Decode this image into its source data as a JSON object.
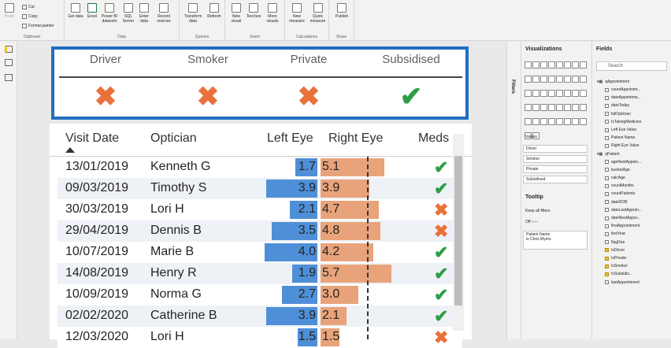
{
  "ribbon": {
    "clipboard": {
      "paste": "Paste",
      "cut": "Cut",
      "copy": "Copy",
      "format_painter": "Format painter",
      "label": "Clipboard"
    },
    "data": {
      "get_data": "Get data",
      "excel": "Excel",
      "power_bi_datasets": "Power BI datasets",
      "sql_server": "SQL Server",
      "enter_data": "Enter data",
      "recent_sources": "Recent sources",
      "label": "Data"
    },
    "queries": {
      "transform_data": "Transform data",
      "refresh": "Refresh",
      "label": "Queries"
    },
    "insert": {
      "new_visual": "New visual",
      "text_box": "Text box",
      "more_visuals": "More visuals",
      "label": "Insert"
    },
    "calculations": {
      "new_measure": "New measure",
      "quick_measure": "Quick measure",
      "label": "Calculations"
    },
    "share": {
      "publish": "Publish",
      "label": "Share"
    }
  },
  "card": {
    "columns": [
      {
        "header": "Driver",
        "status": "cross"
      },
      {
        "header": "Smoker",
        "status": "cross"
      },
      {
        "header": "Private",
        "status": "cross"
      },
      {
        "header": "Subsidised",
        "status": "check"
      }
    ]
  },
  "table": {
    "headers": {
      "visit_date": "Visit Date",
      "optician": "Optician",
      "left_eye": "Left Eye",
      "right_eye": "Right Eye",
      "meds": "Meds"
    },
    "rows": [
      {
        "date": "13/01/2019",
        "optician": "Kenneth G",
        "left": "1.7",
        "right": "5.1",
        "meds": "check"
      },
      {
        "date": "09/03/2019",
        "optician": "Timothy S",
        "left": "3.9",
        "right": "3.9",
        "meds": "check"
      },
      {
        "date": "30/03/2019",
        "optician": "Lori H",
        "left": "2.1",
        "right": "4.7",
        "meds": "cross"
      },
      {
        "date": "29/04/2019",
        "optician": "Dennis B",
        "left": "3.5",
        "right": "4.8",
        "meds": "cross"
      },
      {
        "date": "10/07/2019",
        "optician": "Marie B",
        "left": "4.0",
        "right": "4.2",
        "meds": "check"
      },
      {
        "date": "14/08/2019",
        "optician": "Henry R",
        "left": "1.9",
        "right": "5.7",
        "meds": "check"
      },
      {
        "date": "10/09/2019",
        "optician": "Norma G",
        "left": "2.7",
        "right": "3.0",
        "meds": "check"
      },
      {
        "date": "02/02/2020",
        "optician": "Catherine B",
        "left": "3.9",
        "right": "2.1",
        "meds": "check"
      },
      {
        "date": "12/03/2020",
        "optician": "Lori H",
        "left": "1.5",
        "right": "1.5",
        "meds": "cross"
      }
    ]
  },
  "filters_label": "Filters",
  "visualizations": {
    "title": "Visualizations",
    "values_label": "Values",
    "wells": [
      "Driver",
      "Smoker",
      "Private",
      "Subsidised"
    ],
    "tooltip_title": "Tooltip",
    "keep_all_filters": "Keep all filters",
    "toggle_state": "Off",
    "filter_card_title": "Patient Name",
    "filter_card_value": "is Chris Myers"
  },
  "fields": {
    "title": "Fields",
    "search_placeholder": "Search",
    "tables": [
      {
        "name": "qAppointment",
        "items": [
          {
            "label": "countAppointm...",
            "checked": false
          },
          {
            "label": "dateAppointme...",
            "checked": false
          },
          {
            "label": "dateToday",
            "checked": false
          },
          {
            "label": "fullOptician",
            "checked": false
          },
          {
            "label": "IsTakingMedicine",
            "checked": false
          },
          {
            "label": "Left Eye Value",
            "checked": false
          },
          {
            "label": "Patient Name",
            "checked": false
          },
          {
            "label": "Right Eye Value",
            "checked": false
          }
        ]
      },
      {
        "name": "qPatient",
        "items": [
          {
            "label": "ageNextAppoin...",
            "checked": false
          },
          {
            "label": "bucketAge",
            "checked": false
          },
          {
            "label": "calcAge",
            "checked": false
          },
          {
            "label": "countMonths",
            "checked": false
          },
          {
            "label": "countPatients",
            "checked": false
          },
          {
            "label": "dateDOB",
            "checked": false
          },
          {
            "label": "dateLastAppoin...",
            "checked": false
          },
          {
            "label": "dateNextAppoi...",
            "checked": false
          },
          {
            "label": "firstAppointment",
            "checked": false
          },
          {
            "label": "firstYear",
            "checked": false
          },
          {
            "label": "flagDue",
            "checked": false
          },
          {
            "label": "IsDriver",
            "checked": true
          },
          {
            "label": "IsPrivate",
            "checked": true
          },
          {
            "label": "IsSmoker",
            "checked": true
          },
          {
            "label": "IsSubsidis...",
            "checked": true
          },
          {
            "label": "lastAppointment",
            "checked": false
          }
        ]
      }
    ]
  }
}
